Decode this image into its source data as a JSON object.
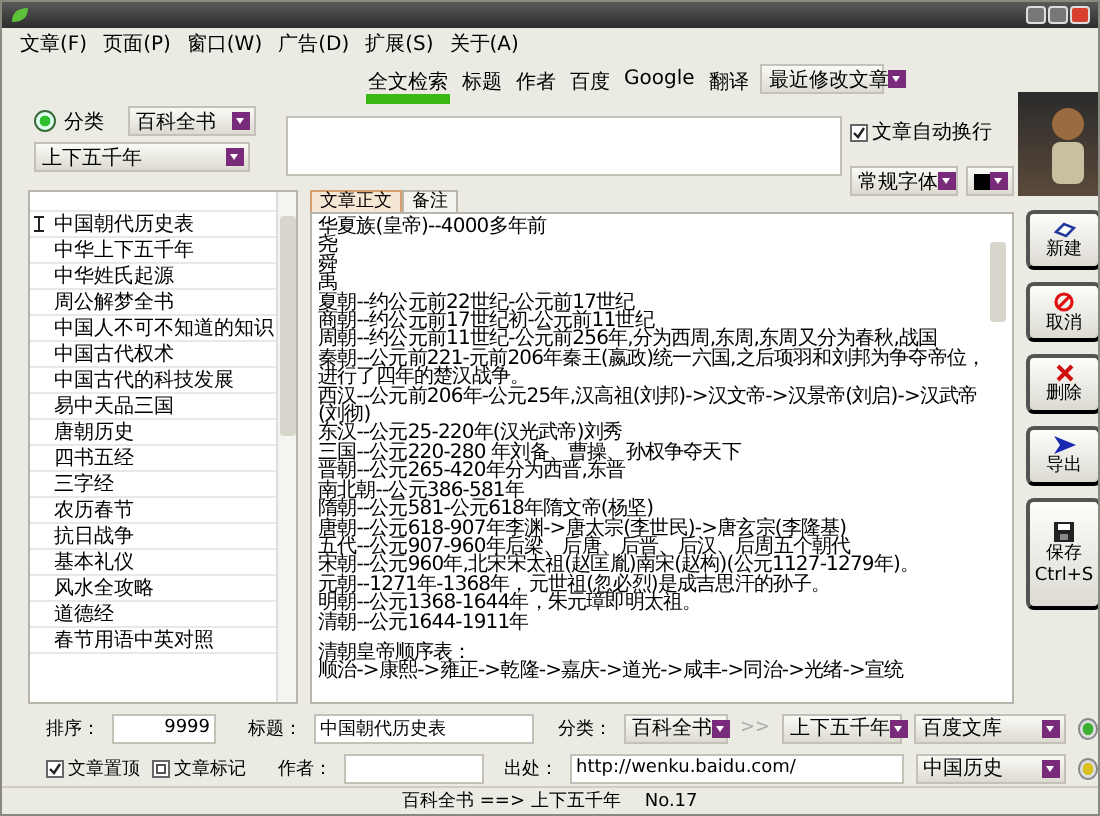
{
  "menu": [
    "文章(F)",
    "页面(P)",
    "窗口(W)",
    "广告(D)",
    "扩展(S)",
    "关于(A)"
  ],
  "search_tabs": [
    {
      "label": "全文检索",
      "selected": true
    },
    {
      "label": "标题",
      "selected": false
    },
    {
      "label": "作者",
      "selected": false
    },
    {
      "label": "百度",
      "selected": false
    },
    {
      "label": "Google",
      "selected": false
    },
    {
      "label": "翻译",
      "selected": false
    }
  ],
  "recent_dropdown": "最近修改文章",
  "category_radio": {
    "label": "分类",
    "selected": true
  },
  "category_dropdown": "百科全书",
  "subcategory_dropdown": "上下五千年",
  "auto_wrap": {
    "label": "文章自动换行",
    "checked": true
  },
  "font_dropdown": "常规字体",
  "list_items": [
    {
      "label": "中国朝代历史表",
      "selected": true
    },
    {
      "label": "中华上下五千年",
      "selected": false
    },
    {
      "label": "中华姓氏起源",
      "selected": false
    },
    {
      "label": "周公解梦全书",
      "selected": false
    },
    {
      "label": "中国人不可不知道的知识",
      "selected": false
    },
    {
      "label": "中国古代权术",
      "selected": false
    },
    {
      "label": "中国古代的科技发展",
      "selected": false
    },
    {
      "label": "易中天品三国",
      "selected": false
    },
    {
      "label": "唐朝历史",
      "selected": false
    },
    {
      "label": "四书五经",
      "selected": false
    },
    {
      "label": "三字经",
      "selected": false
    },
    {
      "label": "农历春节",
      "selected": false
    },
    {
      "label": "抗日战争",
      "selected": false
    },
    {
      "label": "基本礼仪",
      "selected": false
    },
    {
      "label": "风水全攻略",
      "selected": false
    },
    {
      "label": "道德经",
      "selected": false
    },
    {
      "label": "春节用语中英对照",
      "selected": false
    }
  ],
  "content_tabs": [
    {
      "label": "文章正文",
      "selected": true
    },
    {
      "label": "备注",
      "selected": false
    }
  ],
  "content_blocks": [
    [
      "华夏族(皇帝)--4000多年前",
      "尧",
      "舜",
      "禹",
      "夏朝--约公元前22世纪-公元前17世纪",
      "商朝--约公元前17世纪初-公元前11世纪",
      "周朝--约公元前11世纪-公元前256年,分为西周,东周,东周又分为春秋,战国",
      "秦朝--公元前221-元前206年秦王(嬴政)统一六国,之后项羽和刘邦为争夺帝位，进行了四年的楚汉战争。",
      "西汉--公元前206年-公元25年,汉高祖(刘邦)->汉文帝->汉景帝(刘启)->汉武帝(刘彻)",
      "东汉--公元25-220年(汉光武帝)刘秀",
      "三国--公元220-280 年刘备、曹操、孙权争夺天下",
      "晋朝--公元265-420年分为西晋,东晋",
      "南北朝--公元386-581年",
      "隋朝--公元581-公元618年隋文帝(杨坚)",
      "唐朝--公元618-907年李渊->唐太宗(李世民)->唐玄宗(李隆基)",
      "五代--公元907-960年后梁、后唐、后晋、后汉、后周五个朝代",
      "宋朝--公元960年,北宋宋太祖(赵匡胤)南宋(赵构)(公元1127-1279年)。",
      "元朝--1271年-1368年，元世祖(忽必烈)是成吉思汗的孙子。",
      "明朝--公元1368-1644年，朱元璋即明太祖。",
      "清朝--公元1644-1911年"
    ],
    [
      "清朝皇帝顺序表：",
      "顺治->康熙->雍正->乾隆->嘉庆->道光->咸丰->同治->光绪->宣统"
    ]
  ],
  "side_buttons": [
    {
      "kind": "new",
      "label": "新建"
    },
    {
      "kind": "cancel",
      "label": "取消"
    },
    {
      "kind": "delete",
      "label": "删除"
    },
    {
      "kind": "export",
      "label": "导出"
    },
    {
      "kind": "save",
      "label": "保存",
      "shortcut": "Ctrl+S"
    }
  ],
  "form": {
    "sort_label": "排序：",
    "sort_value": "9999",
    "title_label": "标题：",
    "title_value": "中国朝代历史表",
    "category_label": "分类：",
    "category_value": "百科全书",
    "separator": ">>",
    "subcategory_value": "上下五千年",
    "source_dropdown": "百度文库",
    "checkboxes": [
      {
        "label": "文章置顶",
        "checked": true
      },
      {
        "label": "文章标记",
        "indeterminate": true
      }
    ],
    "author_label": "作者：",
    "origin_label": "出处：",
    "origin_value": "http://wenku.baidu.com/",
    "library_dropdown": "中国历史"
  },
  "status_bar": {
    "path": "百科全书 ==> 上下五千年",
    "number": "No.17"
  }
}
